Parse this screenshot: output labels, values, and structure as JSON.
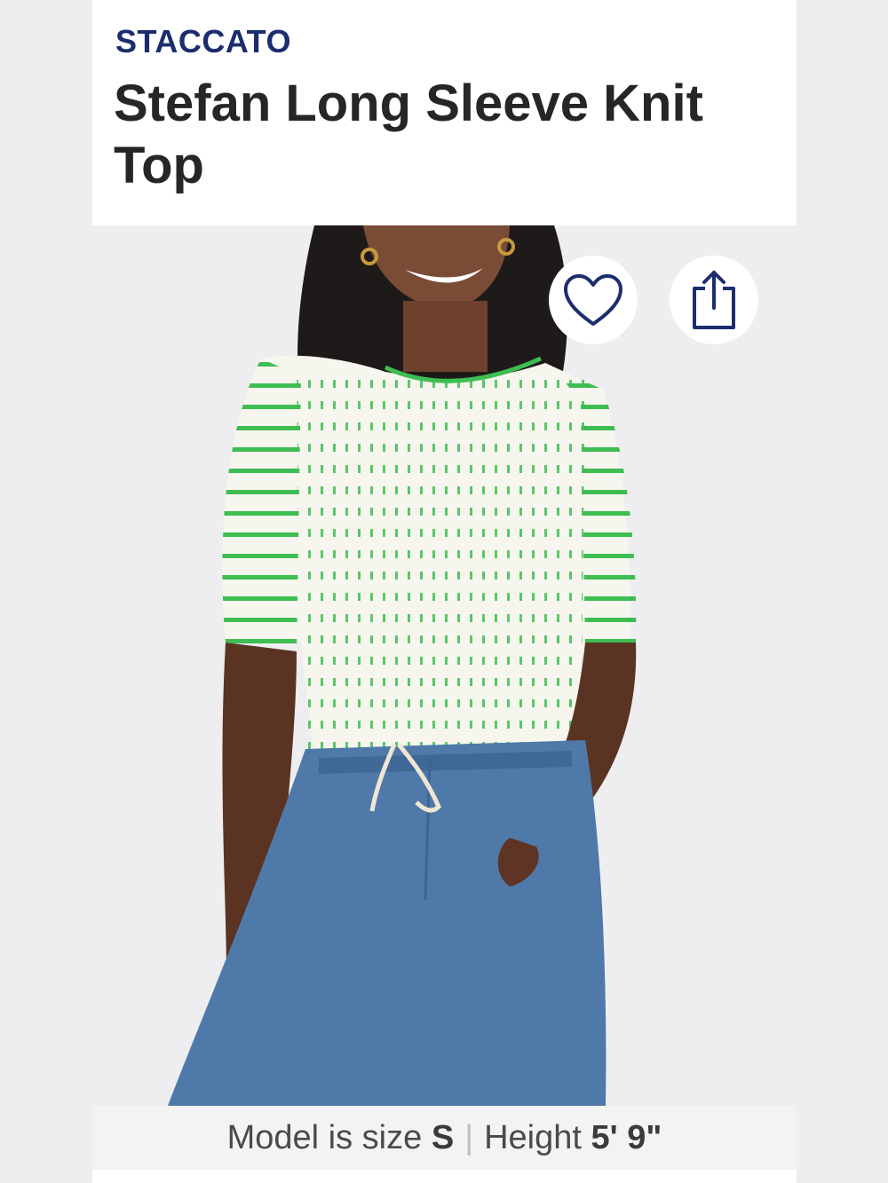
{
  "product": {
    "brand": "STACCATO",
    "title": "Stefan Long Sleeve Knit Top"
  },
  "actions": {
    "favorite_icon": "heart-icon",
    "share_icon": "share-icon"
  },
  "model_info": {
    "size_label": "Model is size",
    "size_value": "S",
    "separator": "|",
    "height_label": "Height",
    "height_value": "5' 9\""
  },
  "colors": {
    "brand": "#1b2d6e",
    "stripe_green": "#2fbf4a",
    "denim": "#4f79a8"
  }
}
